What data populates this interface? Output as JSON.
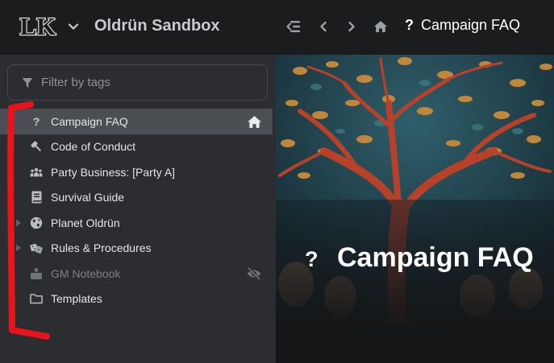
{
  "app": {
    "logo_text": "LK",
    "title": "Oldrün Sandbox"
  },
  "header": {
    "nav_icons": [
      "collapse-sidebar-icon",
      "back-icon",
      "forward-icon",
      "home-icon"
    ],
    "breadcrumb": {
      "icon": "?",
      "title": "Campaign FAQ"
    }
  },
  "sidebar": {
    "filter": {
      "placeholder": "Filter by tags",
      "value": ""
    },
    "items": [
      {
        "label": "Campaign FAQ",
        "icon": "question-icon",
        "icon_glyph": "?",
        "active": true,
        "expandable": false,
        "right_icon": "home-icon"
      },
      {
        "label": "Code of Conduct",
        "icon": "gavel-icon",
        "active": false,
        "expandable": false
      },
      {
        "label": "Party Business: [Party A]",
        "icon": "people-icon",
        "active": false,
        "expandable": false
      },
      {
        "label": "Survival Guide",
        "icon": "book-icon",
        "active": false,
        "expandable": false
      },
      {
        "label": "Planet Oldrün",
        "icon": "globe-icon",
        "active": false,
        "expandable": true
      },
      {
        "label": "Rules & Procedures",
        "icon": "dice-icon",
        "active": false,
        "expandable": true
      },
      {
        "label": "GM Notebook",
        "icon": "gm-icon",
        "active": false,
        "expandable": false,
        "muted": true,
        "right_icon": "hidden-eye-icon"
      },
      {
        "label": "Templates",
        "icon": "folder-icon",
        "active": false,
        "expandable": false
      }
    ]
  },
  "main": {
    "icon": "?",
    "title": "Campaign FAQ"
  },
  "colors": {
    "topbar": "#1b1c1e",
    "sidebar": "#2b2d30",
    "active_item": "#4b4e53",
    "annotation_marker": "#e8141b"
  }
}
